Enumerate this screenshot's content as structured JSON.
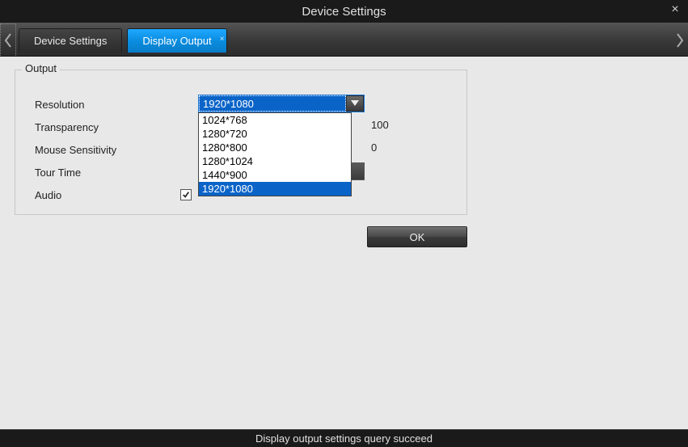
{
  "window": {
    "title": "Device Settings"
  },
  "tabs": [
    {
      "label": "Device Settings",
      "active": false
    },
    {
      "label": "Display Output",
      "active": true
    }
  ],
  "group": {
    "title": "Output",
    "resolution_label": "Resolution",
    "resolution_value": "1920*1080",
    "resolution_options": [
      "1024*768",
      "1280*720",
      "1280*800",
      "1280*1024",
      "1440*900",
      "1920*1080"
    ],
    "resolution_selected_index": 5,
    "transparency_label": "Transparency",
    "transparency_value": "100",
    "mouse_label": "Mouse Sensitivity",
    "mouse_value": "0",
    "tour_label": "Tour Time",
    "audio_label": "Audio",
    "audio_checked": true
  },
  "buttons": {
    "ok": "OK"
  },
  "status": {
    "text": "Display output settings query succeed"
  }
}
